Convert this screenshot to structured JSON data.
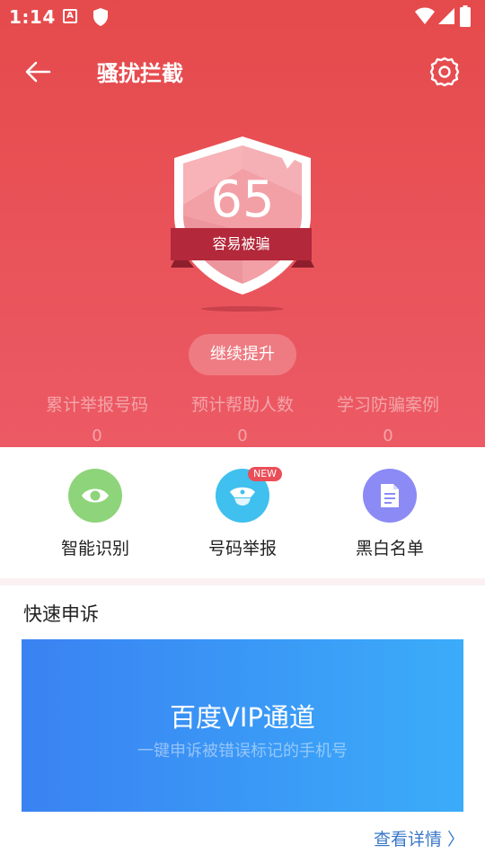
{
  "status_bar": {
    "time": "1:14",
    "icons": [
      "a-icon",
      "shield-icon",
      "wifi-icon",
      "signal-icon",
      "battery-icon"
    ]
  },
  "app_bar": {
    "title": "骚扰拦截",
    "back_icon": "arrow-left-icon",
    "settings_icon": "gear-icon"
  },
  "security": {
    "score": "65",
    "risk_label": "容易被骗",
    "improve_button": "继续提升"
  },
  "stats": [
    {
      "label": "累计举报号码",
      "value": "0"
    },
    {
      "label": "预计帮助人数",
      "value": "0"
    },
    {
      "label": "学习防骗案例",
      "value": "0"
    }
  ],
  "features": [
    {
      "label": "智能识别",
      "icon": "eye-icon",
      "color": "#8ed47a"
    },
    {
      "label": "号码举报",
      "icon": "police-cap-icon",
      "color": "#3fc0ee",
      "badge": "NEW"
    },
    {
      "label": "黑白名单",
      "icon": "document-icon",
      "color": "#8c8af5"
    }
  ],
  "appeal": {
    "section_title": "快速申诉",
    "card_title": "百度VIP通道",
    "card_subtitle": "一键申诉被错误标记的手机号",
    "detail_link": "查看详情 〉"
  },
  "colors": {
    "hero_top": "#e54a4b",
    "hero_bottom": "#ec5a65",
    "ribbon": "#b3283a",
    "vip_left": "#3a82f2",
    "vip_right": "#3bacf9",
    "link": "#3a78c8"
  }
}
